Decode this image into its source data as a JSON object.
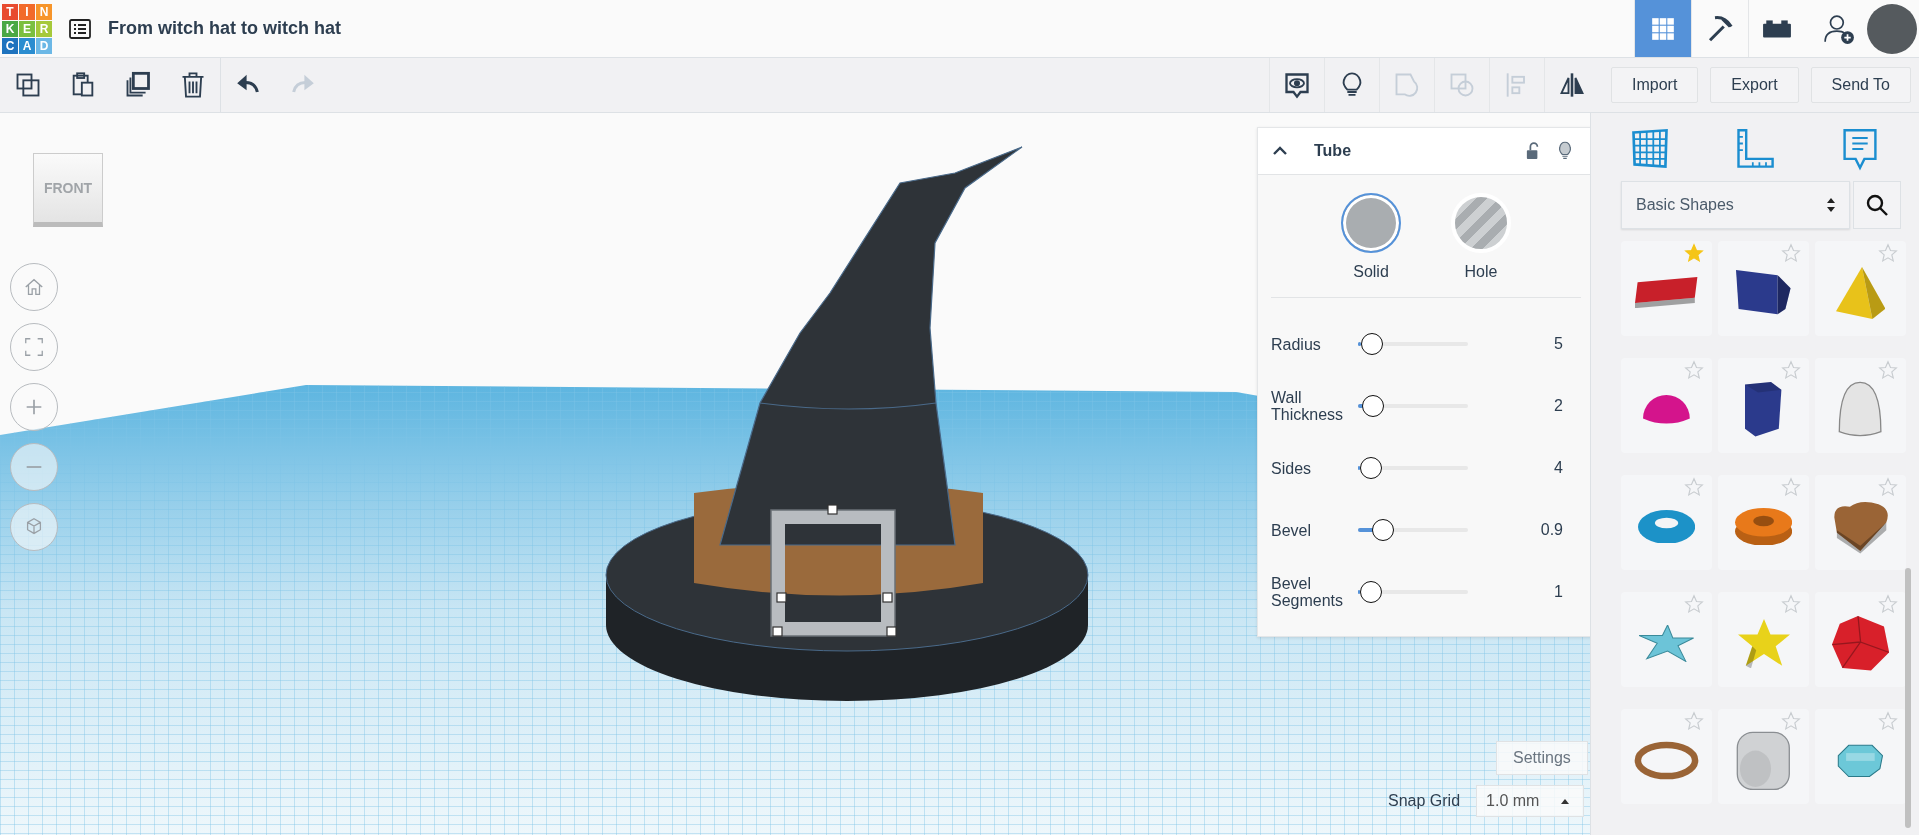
{
  "app": {
    "logo_letters": [
      {
        "letter": "T",
        "color": "#e84b30"
      },
      {
        "letter": "I",
        "color": "#f26a2a"
      },
      {
        "letter": "N",
        "color": "#f7952a"
      },
      {
        "letter": "K",
        "color": "#4aa844"
      },
      {
        "letter": "E",
        "color": "#7bbf3f"
      },
      {
        "letter": "R",
        "color": "#a6c93a"
      },
      {
        "letter": "C",
        "color": "#1e73be"
      },
      {
        "letter": "A",
        "color": "#2b8dd0"
      },
      {
        "letter": "D",
        "color": "#6cb8e6"
      }
    ],
    "title": "From witch hat to witch hat"
  },
  "view_modes": [
    {
      "kind": "grid",
      "selected": true
    },
    {
      "kind": "pickaxe",
      "selected": false
    },
    {
      "kind": "bricks",
      "selected": false
    }
  ],
  "toolbar": {
    "edit_tools": [
      {
        "kind": "copy",
        "disabled": false
      },
      {
        "kind": "paste",
        "disabled": false
      },
      {
        "kind": "duplicate",
        "disabled": false
      },
      {
        "kind": "delete",
        "disabled": false
      },
      {
        "kind": "undo",
        "disabled": false
      },
      {
        "kind": "redo",
        "disabled": true
      }
    ],
    "shape_tools": [
      {
        "kind": "notes",
        "disabled": false
      },
      {
        "kind": "light",
        "disabled": false
      },
      {
        "kind": "group",
        "disabled": true
      },
      {
        "kind": "ungroup",
        "disabled": true
      },
      {
        "kind": "align",
        "disabled": true
      },
      {
        "kind": "mirror",
        "disabled": false
      }
    ],
    "buttons": [
      "Import",
      "Export",
      "Send To"
    ]
  },
  "view_cube": {
    "label": "FRONT"
  },
  "inspector": {
    "title": "Tube",
    "modes": [
      {
        "label": "Solid",
        "kind": "solid",
        "selected": true
      },
      {
        "label": "Hole",
        "kind": "hole",
        "selected": false
      }
    ],
    "parameters": [
      {
        "label": "Radius",
        "value": "5",
        "level": 0.03
      },
      {
        "label": "Wall Thickness",
        "value": "2",
        "level": 0.05
      },
      {
        "label": "Sides",
        "value": "4",
        "level": 0.02
      },
      {
        "label": "Bevel",
        "value": "0.9",
        "level": 0.16
      },
      {
        "label": "Bevel Segments",
        "value": "1",
        "level": 0.02
      }
    ]
  },
  "library": {
    "category": "Basic Shapes",
    "shapes": [
      {
        "kind": "text",
        "color": "#c8202a",
        "favorite": true
      },
      {
        "kind": "box",
        "color": "#2b3a8c",
        "favorite": false
      },
      {
        "kind": "pyramid",
        "color": "#e8c21a",
        "favorite": false
      },
      {
        "kind": "half-sphere",
        "color": "#d4148c",
        "favorite": false
      },
      {
        "kind": "prism",
        "color": "#2b3a8c",
        "favorite": false
      },
      {
        "kind": "paraboloid",
        "color": "#e4e4e4",
        "favorite": false
      },
      {
        "kind": "torus",
        "color": "#1c92c8",
        "favorite": false
      },
      {
        "kind": "tube",
        "color": "#e8791a",
        "favorite": false
      },
      {
        "kind": "heart",
        "color": "#9a6436",
        "favorite": false
      },
      {
        "kind": "star-flat",
        "color": "#6cc4d8",
        "favorite": false
      },
      {
        "kind": "star",
        "color": "#e8d21a",
        "favorite": false
      },
      {
        "kind": "icosahedron",
        "color": "#d8202a",
        "favorite": false
      },
      {
        "kind": "ring",
        "color": "#9a6436",
        "favorite": false
      },
      {
        "kind": "rounded-cube",
        "color": "#d0d2d4",
        "favorite": false
      },
      {
        "kind": "gem",
        "color": "#6cc8d8",
        "favorite": false
      }
    ]
  },
  "settings_button": "Settings",
  "snap_grid": {
    "label": "Snap Grid",
    "value": "1.0 mm"
  }
}
